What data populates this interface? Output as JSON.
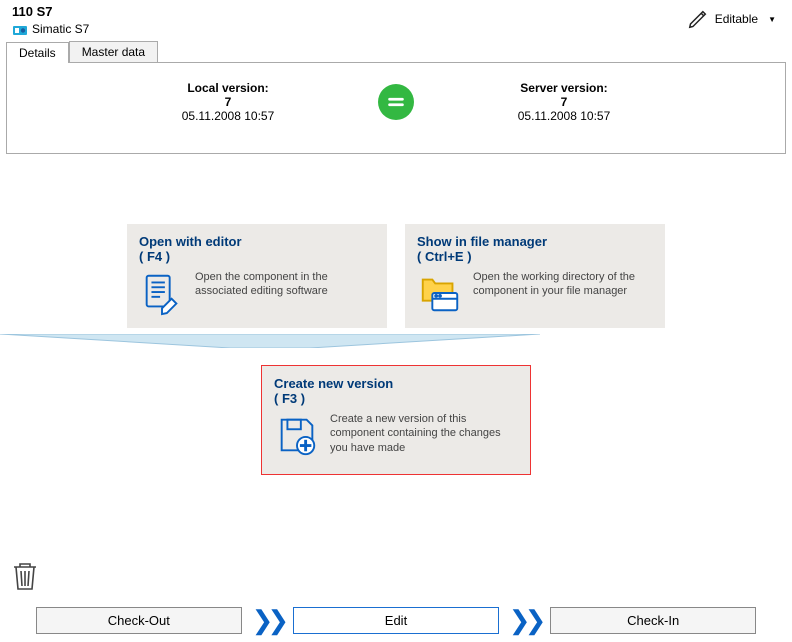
{
  "header": {
    "title": "110 S7",
    "subtitle": "Simatic S7",
    "editable_label": "Editable"
  },
  "tabs": {
    "details": "Details",
    "master": "Master data"
  },
  "versions": {
    "local_label": "Local version:",
    "local_num": "7",
    "local_time": "05.11.2008 10:57",
    "server_label": "Server version:",
    "server_num": "7",
    "server_time": "05.11.2008 10:57"
  },
  "cards": {
    "open": {
      "title": "Open with editor",
      "key": "( F4 )",
      "desc": "Open the component in the associated editing software"
    },
    "show": {
      "title": "Show in file manager",
      "key": "( Ctrl+E )",
      "desc": "Open the working directory of the component in your file manager"
    },
    "create": {
      "title": "Create new version",
      "key": "( F3 )",
      "desc": "Create a new version of this component containing the changes you have made"
    }
  },
  "steps": {
    "checkout": "Check-Out",
    "edit": "Edit",
    "checkin": "Check-In"
  }
}
